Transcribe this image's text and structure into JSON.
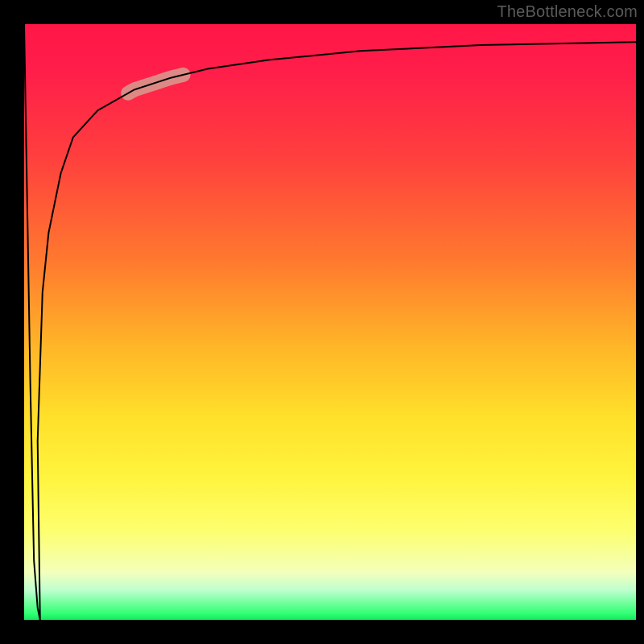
{
  "watermark": "TheBottleneck.com",
  "chart_data": {
    "type": "line",
    "title": "",
    "xlabel": "",
    "ylabel": "",
    "xlim": [
      0,
      100
    ],
    "ylim": [
      0,
      100
    ],
    "grid": false,
    "legend": false,
    "background_gradient": {
      "direction": "top-to-bottom",
      "stops": [
        {
          "t": 0.0,
          "color": "#ff1647"
        },
        {
          "t": 0.22,
          "color": "#ff3e3e"
        },
        {
          "t": 0.4,
          "color": "#ff7a2e"
        },
        {
          "t": 0.66,
          "color": "#ffe02a"
        },
        {
          "t": 0.85,
          "color": "#fdff6e"
        },
        {
          "t": 0.95,
          "color": "#bfffd0"
        },
        {
          "t": 1.0,
          "color": "#14e85e"
        }
      ]
    },
    "series": [
      {
        "name": "bottleneck-curve",
        "color": "#000000",
        "stroke_width": 2,
        "x": [
          0,
          1.0,
          1.6,
          2.2,
          2.6,
          2.2,
          3,
          4,
          6,
          8,
          12,
          18,
          24,
          30,
          40,
          55,
          75,
          100
        ],
        "values": [
          100,
          40,
          10,
          2,
          0,
          30,
          55,
          65,
          75,
          81,
          85.5,
          89,
          91,
          92.5,
          94,
          95.5,
          96.5,
          97
        ]
      }
    ],
    "highlight_segment": {
      "on_series": "bottleneck-curve",
      "x_range": [
        17,
        26
      ],
      "color": "#d79c90",
      "opacity": 0.85,
      "stroke_width": 18
    }
  }
}
